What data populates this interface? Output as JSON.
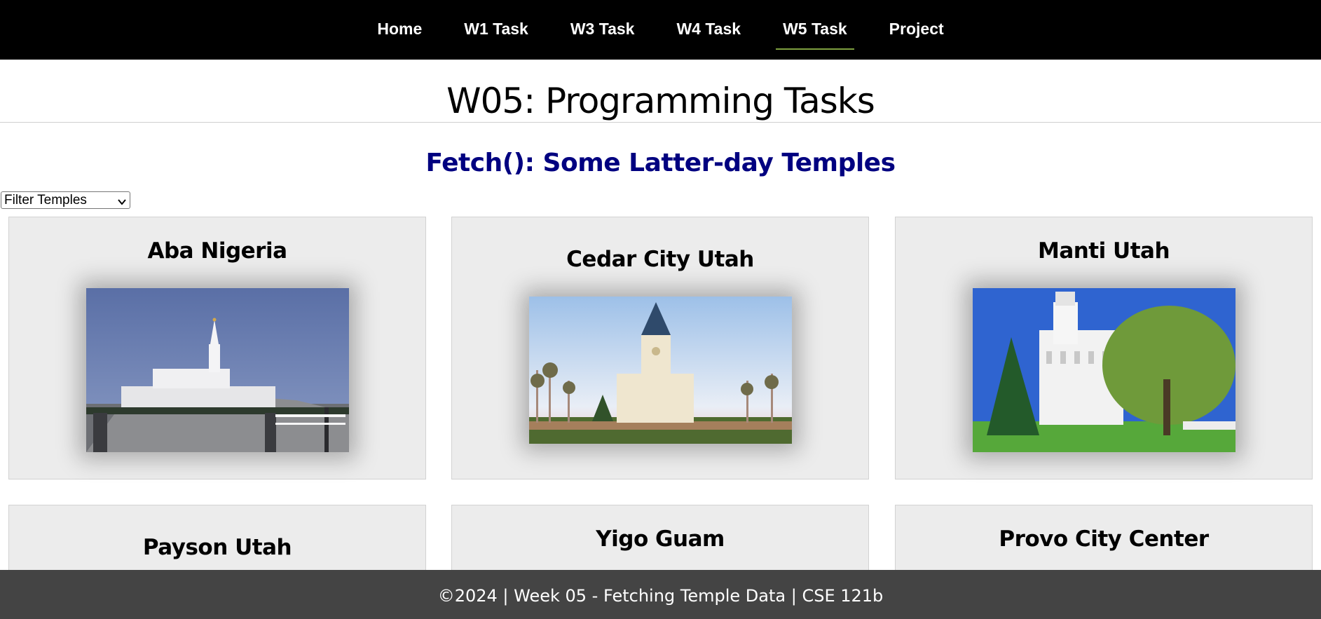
{
  "nav": {
    "items": [
      {
        "label": "Home"
      },
      {
        "label": "W1 Task"
      },
      {
        "label": "W3 Task"
      },
      {
        "label": "W4 Task"
      },
      {
        "label": "W5 Task",
        "active": true
      },
      {
        "label": "Project"
      }
    ],
    "active_underline_color": "#7fa040"
  },
  "main": {
    "title": "W05: Programming Tasks",
    "section_title": "Fetch(): Some Latter-day Temples",
    "filter": {
      "selected": "Filter Temples"
    },
    "temples": [
      {
        "name": "Aba Nigeria"
      },
      {
        "name": "Cedar City Utah"
      },
      {
        "name": "Manti Utah"
      },
      {
        "name": "Payson Utah"
      },
      {
        "name": "Yigo Guam"
      },
      {
        "name": "Provo City Center"
      }
    ]
  },
  "footer": {
    "text": "©2024 | Week 05 - Fetching Temple Data | CSE 121b"
  },
  "colors": {
    "nav_bg": "#000000",
    "section_title": "#000080",
    "card_bg": "#ececec",
    "footer_bg": "#444444"
  }
}
